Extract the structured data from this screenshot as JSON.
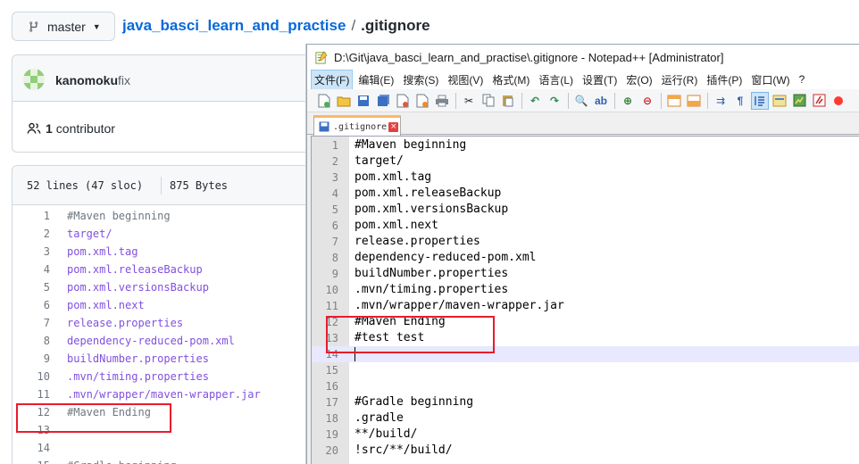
{
  "github": {
    "branch": "master",
    "repo_name": "java_basci_learn_and_practise",
    "separator": "/",
    "file_name": ".gitignore",
    "commit_user": "kanomoku",
    "commit_message": "fix",
    "contributor_count": "1",
    "contributor_label": "contributor",
    "lines_info": "52 lines (47 sloc)",
    "size_info": "875 Bytes",
    "code_lines": [
      {
        "n": "1",
        "t": "#Maven beginning",
        "k": "cmt"
      },
      {
        "n": "2",
        "t": "target/",
        "k": "pth"
      },
      {
        "n": "3",
        "t": "pom.xml.tag",
        "k": "pth"
      },
      {
        "n": "4",
        "t": "pom.xml.releaseBackup",
        "k": "pth"
      },
      {
        "n": "5",
        "t": "pom.xml.versionsBackup",
        "k": "pth"
      },
      {
        "n": "6",
        "t": "pom.xml.next",
        "k": "pth"
      },
      {
        "n": "7",
        "t": "release.properties",
        "k": "pth"
      },
      {
        "n": "8",
        "t": "dependency-reduced-pom.xml",
        "k": "pth"
      },
      {
        "n": "9",
        "t": "buildNumber.properties",
        "k": "pth"
      },
      {
        "n": "10",
        "t": ".mvn/timing.properties",
        "k": "pth"
      },
      {
        "n": "11",
        "t": ".mvn/wrapper/maven-wrapper.jar",
        "k": "pth"
      },
      {
        "n": "12",
        "t": "#Maven Ending",
        "k": "cmt"
      },
      {
        "n": "13",
        "t": "",
        "k": "pth"
      },
      {
        "n": "14",
        "t": "",
        "k": "pth"
      },
      {
        "n": "15",
        "t": "#Gradle beginning",
        "k": "cmt"
      }
    ]
  },
  "npp": {
    "title": "D:\\Git\\java_basci_learn_and_practise\\.gitignore - Notepad++ [Administrator]",
    "menu": [
      "文件(F)",
      "编辑(E)",
      "搜索(S)",
      "视图(V)",
      "格式(M)",
      "语言(L)",
      "设置(T)",
      "宏(O)",
      "运行(R)",
      "插件(P)",
      "窗口(W)",
      "?"
    ],
    "tab_name": ".gitignore",
    "lines": [
      {
        "n": "1",
        "t": "#Maven beginning"
      },
      {
        "n": "2",
        "t": "target/"
      },
      {
        "n": "3",
        "t": "pom.xml.tag"
      },
      {
        "n": "4",
        "t": "pom.xml.releaseBackup"
      },
      {
        "n": "5",
        "t": "pom.xml.versionsBackup"
      },
      {
        "n": "6",
        "t": "pom.xml.next"
      },
      {
        "n": "7",
        "t": "release.properties"
      },
      {
        "n": "8",
        "t": "dependency-reduced-pom.xml"
      },
      {
        "n": "9",
        "t": "buildNumber.properties"
      },
      {
        "n": "10",
        "t": ".mvn/timing.properties"
      },
      {
        "n": "11",
        "t": ".mvn/wrapper/maven-wrapper.jar"
      },
      {
        "n": "12",
        "t": "#Maven Ending"
      },
      {
        "n": "13",
        "t": "#test test"
      },
      {
        "n": "14",
        "t": ""
      },
      {
        "n": "15",
        "t": ""
      },
      {
        "n": "16",
        "t": ""
      },
      {
        "n": "17",
        "t": "#Gradle beginning"
      },
      {
        "n": "18",
        "t": ".gradle"
      },
      {
        "n": "19",
        "t": "**/build/"
      },
      {
        "n": "20",
        "t": "!src/**/build/"
      }
    ]
  },
  "colors": {
    "link_blue": "#0969da",
    "highlight_red": "#e81c2c",
    "current_line": "#e8e8ff",
    "tab_accent": "#fab86a"
  }
}
